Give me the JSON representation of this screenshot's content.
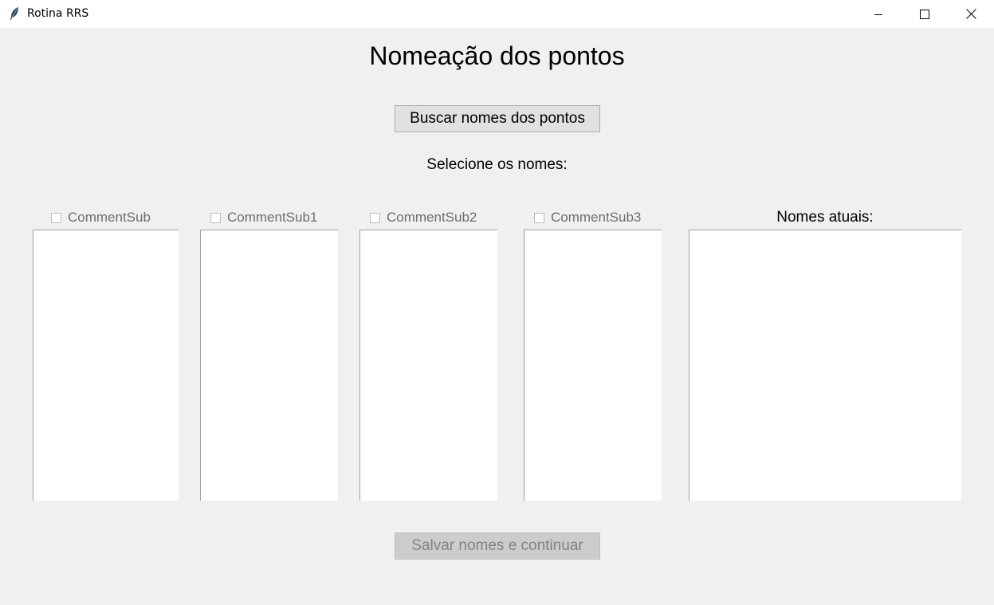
{
  "window": {
    "title": "Rotina RRS",
    "icon": "feather-icon"
  },
  "main": {
    "heading": "Nomeação dos pontos",
    "fetch_button": "Buscar nomes dos pontos",
    "select_label": "Selecione os nomes:",
    "columns": [
      {
        "label": "CommentSub",
        "checked": false
      },
      {
        "label": "CommentSub1",
        "checked": false
      },
      {
        "label": "CommentSub2",
        "checked": false
      },
      {
        "label": "CommentSub3",
        "checked": false
      }
    ],
    "current_names_label": "Nomes atuais:",
    "save_button": "Salvar nomes e continuar"
  }
}
